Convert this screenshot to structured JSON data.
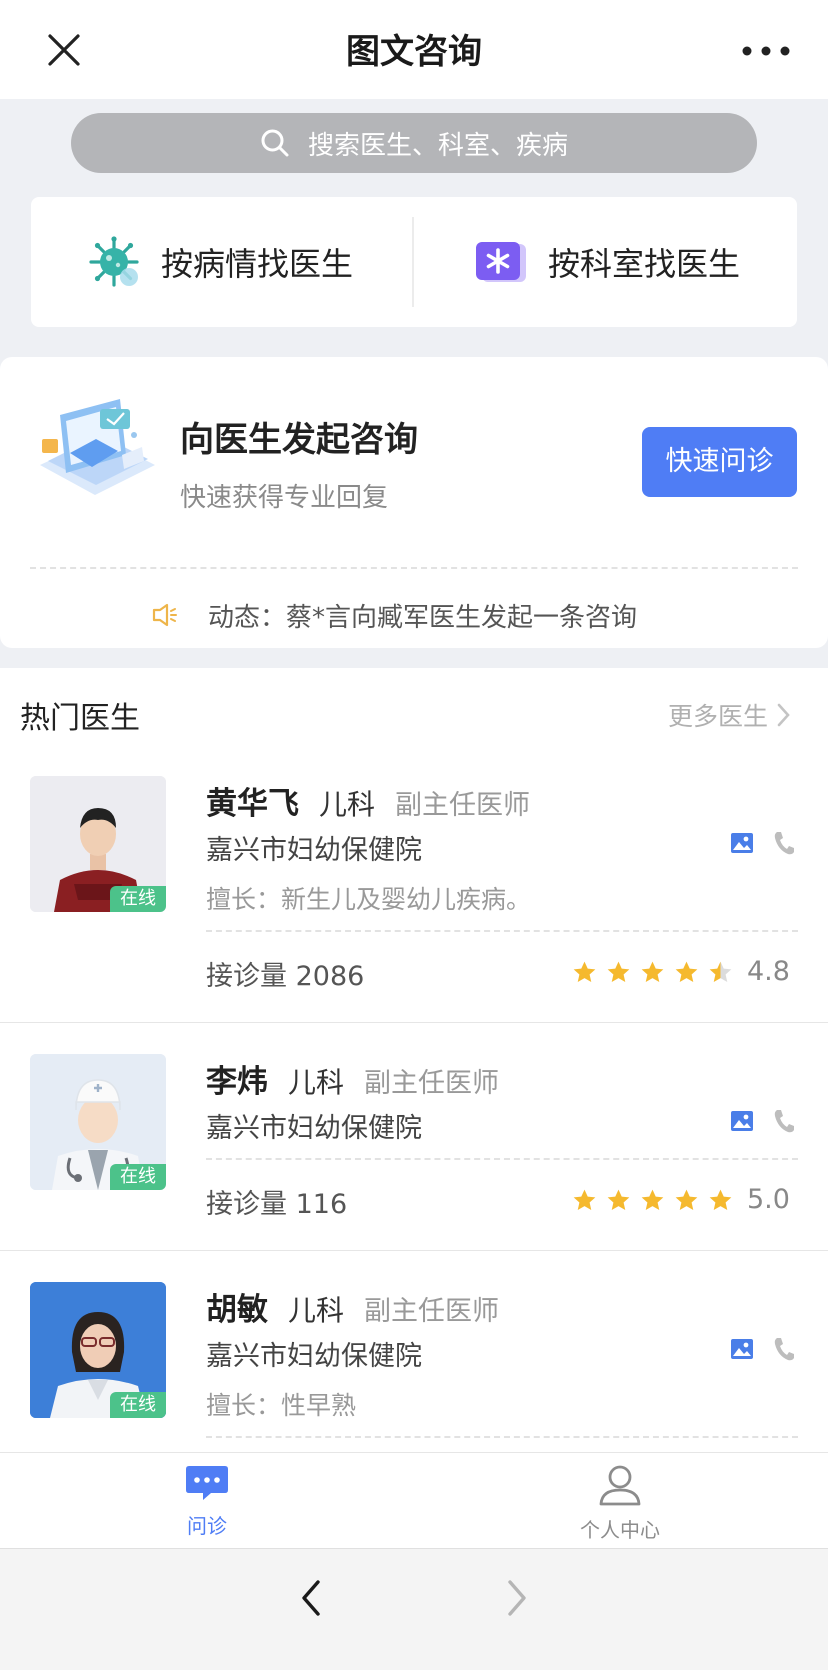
{
  "header": {
    "title": "图文咨询"
  },
  "search": {
    "placeholder": "搜索医生、科室、疾病"
  },
  "entries": {
    "by_disease": "按病情找医生",
    "by_department": "按科室找医生"
  },
  "consult": {
    "title": "向医生发起咨询",
    "subtitle": "快速获得专业回复",
    "button": "快速问诊",
    "ticker": "动态：蔡*言向臧军医生发起一条咨询"
  },
  "hot": {
    "title": "热门医生",
    "more": "更多医生",
    "doctors": [
      {
        "name": "黄华飞",
        "dept": "儿科",
        "title": "副主任医师",
        "hospital": "嘉兴市妇幼保健院",
        "specialty": "擅长：新生儿及婴幼儿疾病。",
        "count": "接诊量 2086",
        "rating": "4.8",
        "status": "在线"
      },
      {
        "name": "李炜",
        "dept": "儿科",
        "title": "副主任医师",
        "hospital": "嘉兴市妇幼保健院",
        "specialty": "",
        "count": "接诊量 116",
        "rating": "5.0",
        "status": "在线"
      },
      {
        "name": "胡敏",
        "dept": "儿科",
        "title": "副主任医师",
        "hospital": "嘉兴市妇幼保健院",
        "specialty": "擅长：性早熟",
        "count": "",
        "rating": "",
        "status": "在线"
      }
    ]
  },
  "tabs": [
    {
      "label": "问诊",
      "active": true
    },
    {
      "label": "个人中心",
      "active": false
    }
  ],
  "colors": {
    "accent": "#4f7df5",
    "online": "#4cc28a",
    "star": "#f5b92e",
    "star_empty": "#dcdcdc"
  },
  "icons": [
    "close-icon",
    "more-icon",
    "search-icon",
    "virus-icon",
    "asterisk-icon",
    "consult-illustration",
    "speaker-icon",
    "chevron-right-icon",
    "image-icon",
    "phone-icon",
    "star-icon",
    "chat-icon",
    "user-icon",
    "back-icon",
    "forward-icon"
  ]
}
